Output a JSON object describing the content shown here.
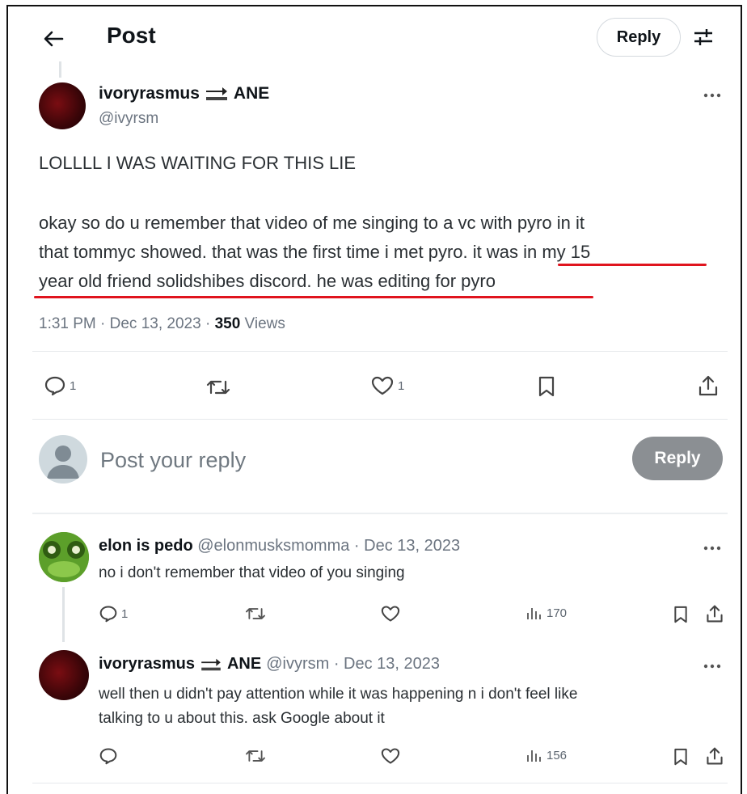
{
  "header": {
    "title": "Post",
    "reply_label": "Reply"
  },
  "main_tweet": {
    "display_name": "ivoryrasmus",
    "name_suffix": "ANE",
    "handle": "@ivyrsm",
    "line1": "LOLLLL I WAS WAITING FOR THIS LIE",
    "body_lines": [
      "okay so do u remember that video of me singing to a vc with pyro in it",
      "that tommyc showed. that was the first time i met pyro.",
      " it was in my 15",
      "year old friend solidshibes discord. he was editing for pyro"
    ],
    "time": "1:31 PM · Dec 13, 2023 · ",
    "views_count": "350",
    "views_label": " Views",
    "reply_count": "1",
    "like_count": "1"
  },
  "compose": {
    "placeholder": "Post your reply",
    "button_label": "Reply"
  },
  "replies": [
    {
      "display_name": "elon is pedo",
      "meta": "@elonmusksmomma · Dec 13, 2023",
      "text": "no i don't remember that video of you singing",
      "reply_count": "1",
      "views": "170"
    },
    {
      "display_name": "ivoryrasmus",
      "name_suffix": "ANE",
      "meta": "@ivyrsm · Dec 13, 2023",
      "text_lines": [
        "well then u didn't pay attention while it was happening n i don't feel like",
        "talking to u about this. ask Google about it"
      ],
      "views": "156"
    }
  ],
  "colors": {
    "underline": "#e0141e",
    "reply_button_bg": "#8b8f93",
    "avatar_dark": "#3a0508",
    "avatar_green": "#5aa02c"
  }
}
